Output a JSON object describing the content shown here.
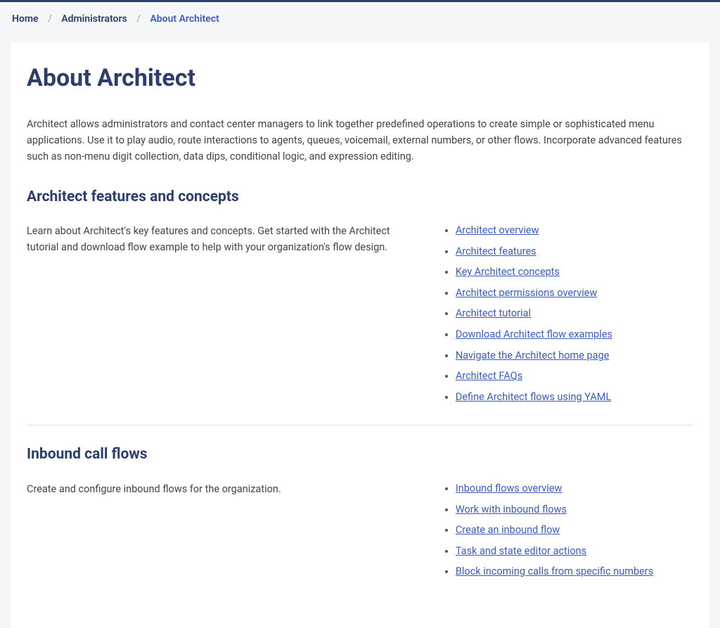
{
  "breadcrumb": {
    "home": "Home",
    "administrators": "Administrators",
    "current": "About Architect"
  },
  "page": {
    "title": "About Architect",
    "intro": "Architect allows administrators and contact center managers to link together predefined operations to create simple or sophisticated menu applications. Use it to play audio, route interactions to agents, queues, voicemail, external numbers, or other flows. Incorporate advanced features such as non-menu digit collection, data dips, conditional logic, and expression editing."
  },
  "sections": [
    {
      "heading": "Architect features and concepts",
      "description": "Learn about Architect's key features and concepts. Get started with the Architect tutorial and download flow example to help with your organization's flow design.",
      "links": [
        "Architect overview",
        "Architect features",
        "Key Architect concepts",
        "Architect permissions overview",
        "Architect tutorial",
        "Download Architect flow examples",
        "Navigate the Architect home page",
        "Architect FAQs",
        "Define Architect flows using YAML"
      ]
    },
    {
      "heading": "Inbound call flows",
      "description": "Create and configure inbound flows for the organization.",
      "links": [
        "Inbound flows overview",
        "Work with inbound flows",
        "Create an inbound flow",
        "Task and state editor actions",
        "Block incoming calls from specific numbers"
      ]
    }
  ]
}
